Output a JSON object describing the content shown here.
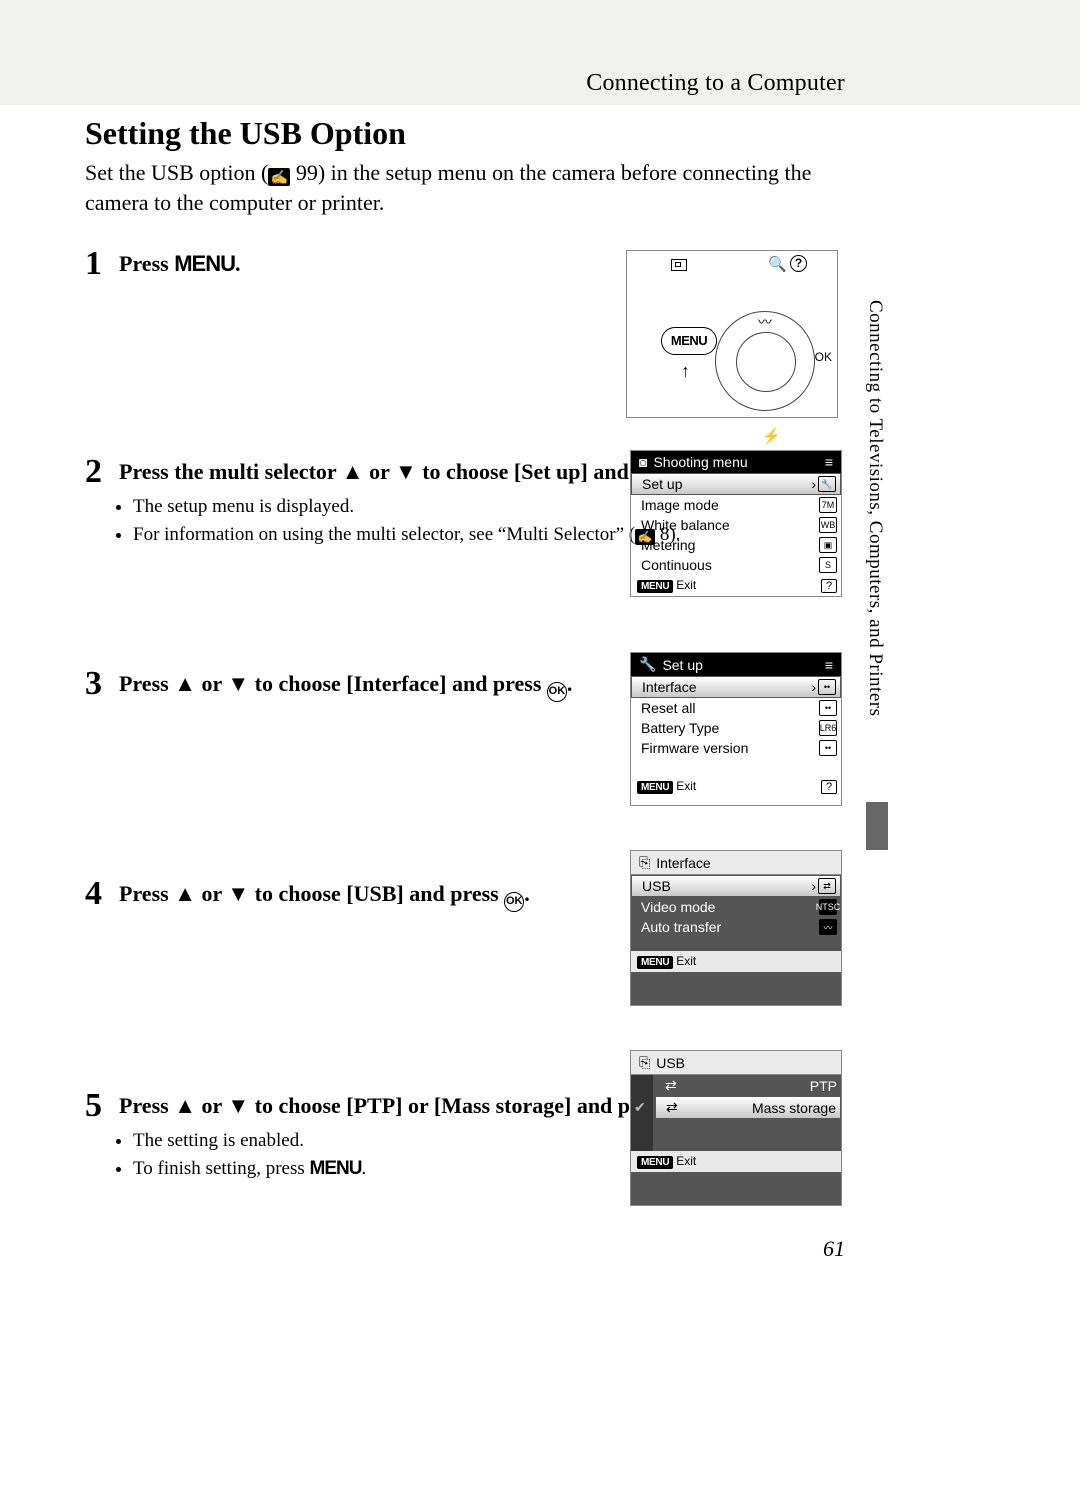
{
  "header": "Connecting to a Computer",
  "side_text": "Connecting to Televisions, Computers, and Printers",
  "page_number": "61",
  "title": "Setting the USB Option",
  "intro": {
    "pre": "Set the USB option (",
    "page_ref": " 99",
    "post": ") in the setup menu on the camera before connecting the camera to the computer or printer."
  },
  "menu_label": "MENU",
  "ok_label": "OK",
  "steps": {
    "s1": {
      "num": "1",
      "heading_a": "Press ",
      "heading_b": "."
    },
    "s2": {
      "num": "2",
      "heading_a": "Press the multi selector ",
      "heading_mid": " or ",
      "heading_b": " to choose [Set up] and press ",
      "heading_end": ".",
      "bullet1": "The setup menu is displayed.",
      "bullet2_a": "For information on using the multi selector, see “Multi Selector” (",
      "bullet2_ref": " 8",
      "bullet2_b": ")."
    },
    "s3": {
      "num": "3",
      "heading_a": "Press ",
      "heading_mid": " or ",
      "heading_b": " to choose [Interface] and press ",
      "heading_end": "."
    },
    "s4": {
      "num": "4",
      "heading_a": "Press ",
      "heading_mid": " or ",
      "heading_b": " to choose [USB] and press ",
      "heading_end": "."
    },
    "s5": {
      "num": "5",
      "heading_a": "Press ",
      "heading_mid": " or ",
      "heading_b": " to choose [PTP] or [Mass storage] and press ",
      "heading_end": ".",
      "bullet1": "The setting is enabled.",
      "bullet2_a": "To finish setting, press ",
      "bullet2_b": "."
    }
  },
  "fig1": {
    "menu": "MENU",
    "help": "?",
    "flash": "⚡"
  },
  "fig2": {
    "title": "Shooting menu",
    "items": [
      "Set up",
      "Image mode",
      "White balance",
      "Metering",
      "Continuous"
    ],
    "exit": "Exit"
  },
  "fig3": {
    "title": "Set up",
    "items": [
      "Interface",
      "Reset all",
      "Battery Type",
      "Firmware version"
    ],
    "exit": "Exit"
  },
  "fig4": {
    "title": "Interface",
    "items": [
      "USB",
      "Video mode",
      "Auto transfer"
    ],
    "exit": "Exit"
  },
  "fig5": {
    "title": "USB",
    "items": [
      "PTP",
      "Mass storage"
    ],
    "exit": "Exit"
  }
}
